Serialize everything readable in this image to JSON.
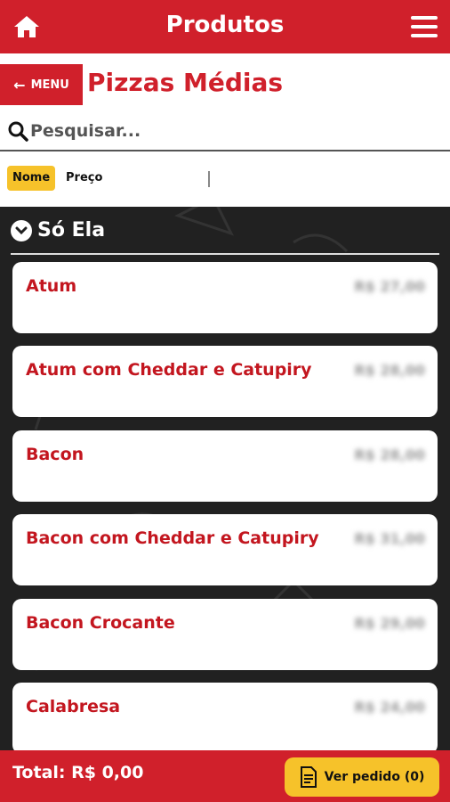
{
  "topbar": {
    "title": "Produtos",
    "home_icon": "home-icon",
    "menu_icon": "hamburger-icon"
  },
  "section": {
    "back_label": "MENU",
    "title": "Pizzas Médias"
  },
  "search": {
    "placeholder": "Pesquisar..."
  },
  "sort": {
    "options": [
      "Nome",
      "Preço"
    ],
    "selected": "Nome"
  },
  "group": {
    "title": "Só Ela"
  },
  "products": [
    {
      "name": "Atum",
      "price": "R$ 27,00"
    },
    {
      "name": "Atum com Cheddar e Catupiry",
      "price": "R$ 28,00"
    },
    {
      "name": "Bacon",
      "price": "R$ 28,00"
    },
    {
      "name": "Bacon com Cheddar e Catupiry",
      "price": "R$ 31,00"
    },
    {
      "name": "Bacon Crocante",
      "price": "R$ 29,00"
    },
    {
      "name": "Calabresa",
      "price": "R$ 24,00"
    }
  ],
  "footer": {
    "total": "Total: R$ 0,00",
    "order_label": "Ver pedido (0)"
  },
  "colors": {
    "brand": "#d0202b",
    "accent": "#f6c22a",
    "list_bg": "#212121"
  }
}
